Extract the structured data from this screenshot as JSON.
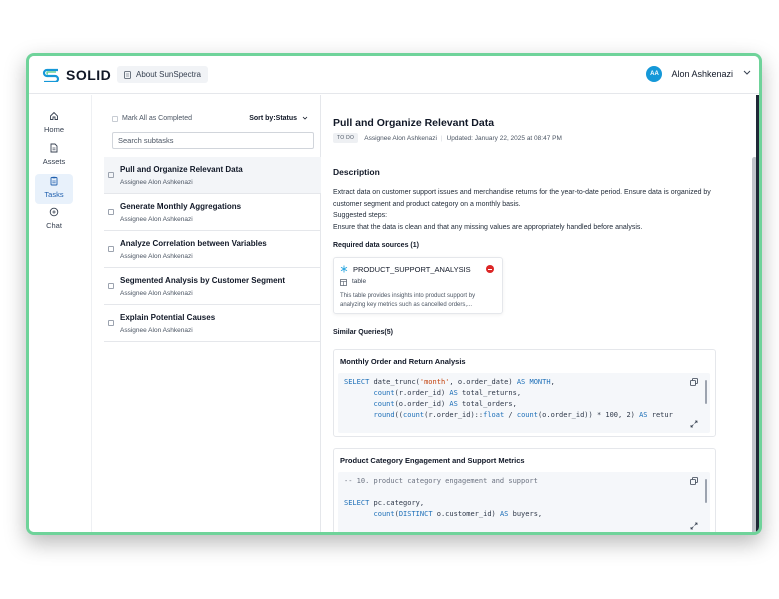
{
  "app": {
    "logo_text": "SOLID",
    "about_label": "About SunSpectra",
    "user": {
      "initials": "AA",
      "name": "Alon Ashkenazi"
    }
  },
  "sidebar": {
    "items": [
      {
        "label": "Home",
        "icon": "home-icon"
      },
      {
        "label": "Assets",
        "icon": "file-icon"
      },
      {
        "label": "Tasks",
        "icon": "clipboard-icon",
        "active": true
      },
      {
        "label": "Chat",
        "icon": "chat-icon"
      }
    ]
  },
  "tasks_panel": {
    "mark_all_label": "Mark All as Completed",
    "sort_label": "Sort by:Status",
    "search_placeholder": "Search subtasks",
    "tasks": [
      {
        "name": "Pull and Organize Relevant Data",
        "assignee": "Assignee Alon Ashkenazi"
      },
      {
        "name": "Generate Monthly Aggregations",
        "assignee": "Assignee Alon Ashkenazi"
      },
      {
        "name": "Analyze Correlation between Variables",
        "assignee": "Assignee Alon Ashkenazi"
      },
      {
        "name": "Segmented Analysis by Customer Segment",
        "assignee": "Assignee Alon Ashkenazi"
      },
      {
        "name": "Explain Potential Causes",
        "assignee": "Assignee Alon Ashkenazi"
      }
    ]
  },
  "detail": {
    "title": "Pull and Organize Relevant Data",
    "status": "TO DO",
    "assignee": "Assignee Alon Ashkenazi",
    "updated": "Updated: January 22, 2025 at 08:47 PM",
    "description_heading": "Description",
    "description_lines": [
      "Extract data on customer support issues and merchandise returns for the year-to-date period. Ensure data is organized by customer segment and product category on a monthly basis.",
      "Suggested steps:",
      "Ensure that the data is clean and that any missing values are appropriately handled before analysis."
    ],
    "required_sources_heading": "Required data sources (1)",
    "source": {
      "name": "PRODUCT_SUPPORT_ANALYSIS",
      "type": "table",
      "description": "This table provides insights into product support by analyzing key metrics such as cancelled orders,..."
    },
    "similar_queries_heading": "Similar Queries(5)",
    "queries": [
      {
        "title": "Monthly Order and Return Analysis"
      },
      {
        "title": "Product Category Engagement and Support Metrics"
      }
    ]
  },
  "colors": {
    "accent": "#1598d8",
    "frame_border": "#6fd39a",
    "remove": "#dc2626",
    "active_nav_bg": "#e8f1fb"
  }
}
